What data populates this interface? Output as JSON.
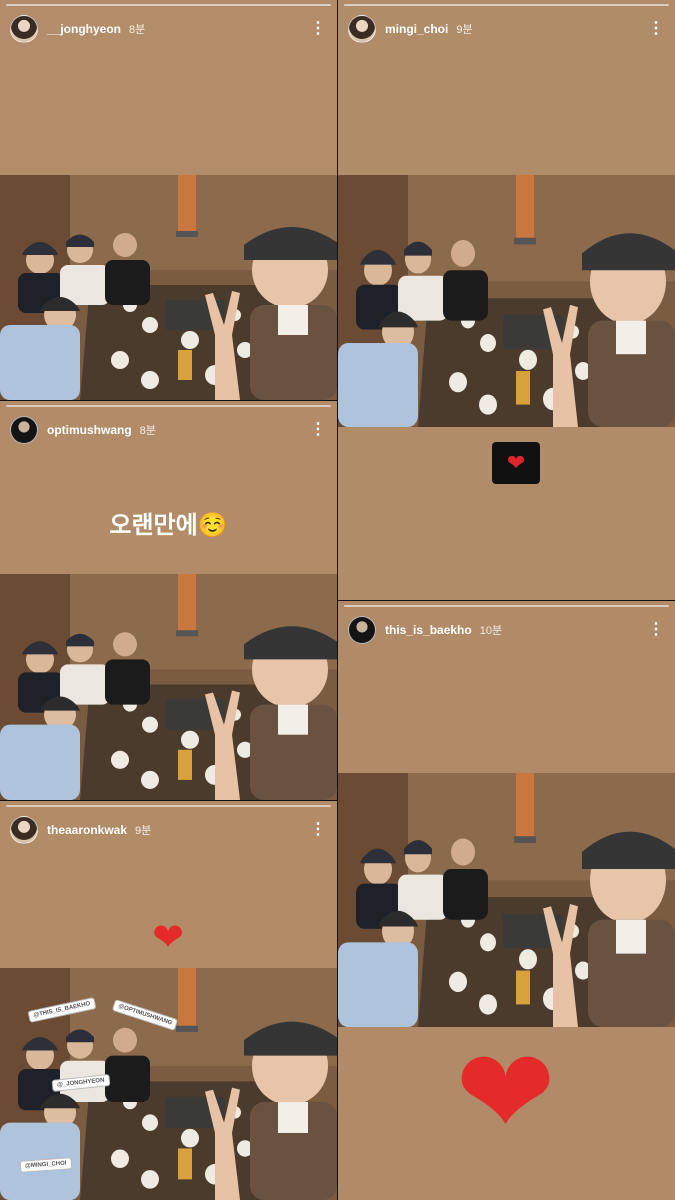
{
  "stories": [
    {
      "username": "__jonghyeon",
      "time": "8분"
    },
    {
      "username": "mingi_choi",
      "time": "9분",
      "sticker_icon": "heart-icon"
    },
    {
      "username": "optimushwang",
      "time": "8분",
      "caption": "오랜만에☺️"
    },
    {
      "username": "this_is_baekho",
      "time": "10분",
      "sticker_icon": "heart-icon"
    },
    {
      "username": "theaaronkwak",
      "time": "9분",
      "sticker_icon": "heart-icon",
      "mentions": [
        "@THIS_IS_BAEKHO",
        "@OPTIMUSHWANG",
        "@_JONGHYEON",
        "@MINGI_CHOI"
      ]
    }
  ],
  "colors": {
    "story_bg": "#b08a66",
    "heart": "#e52a2a"
  }
}
